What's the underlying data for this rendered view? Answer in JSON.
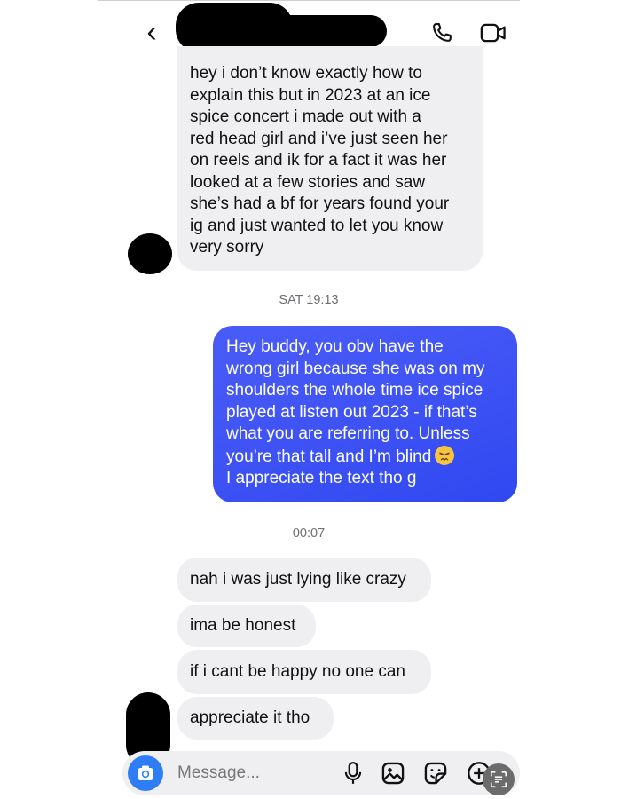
{
  "header": {
    "back_glyph": "‹",
    "call_icon": "phone-icon",
    "video_icon": "video-call-icon"
  },
  "messages": {
    "first_lines": [
      "hey i don’t know exactly how to",
      "explain this but in 2023 at an ice",
      "spice concert i made out with a",
      "red head girl and i’ve just seen her",
      "on reels and ik for a fact it was her",
      "looked at a few stories and saw",
      "she’s had a bf for years found your",
      "ig and just wanted to let you know",
      "very sorry"
    ],
    "timestamp_1": "SAT 19:13",
    "reply_lines": [
      "Hey buddy, you obv have the",
      "wrong girl because she was on my",
      "shoulders the whole time ice spice",
      "played at listen out 2023 - if that’s",
      "what you are referring to. Unless",
      "you’re that tall and I’m blind",
      "I appreciate the text tho g"
    ],
    "reply_emoji": "persevering-face-emoji",
    "timestamp_2": "00:07",
    "followups": [
      "nah i was just lying like crazy",
      "ima be honest",
      "if i cant be happy no one can",
      "appreciate it tho"
    ]
  },
  "composer": {
    "placeholder": "Message...",
    "icons": [
      "camera-icon",
      "microphone-icon",
      "gallery-icon",
      "sticker-icon",
      "add-icon",
      "scan-text-icon"
    ]
  },
  "colors": {
    "outgoing_bubble": "#3f53f5",
    "incoming_bubble": "#efeff1",
    "camera_button": "#2f7df6"
  }
}
